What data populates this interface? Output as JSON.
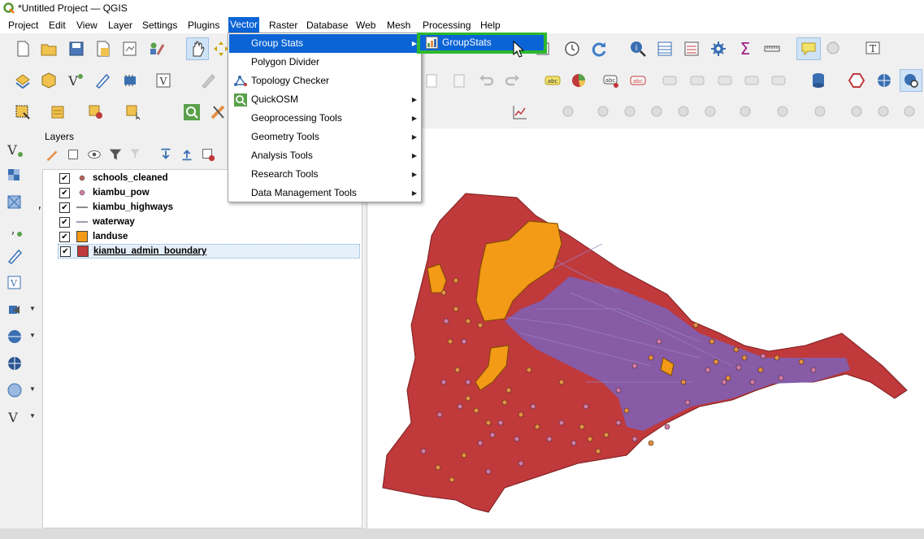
{
  "window": {
    "title": "*Untitled Project — QGIS"
  },
  "menubar": {
    "items": [
      "Project",
      "Edit",
      "View",
      "Layer",
      "Settings",
      "Plugins",
      "Vector",
      "Raster",
      "Database",
      "Web",
      "Mesh",
      "Processing",
      "Help"
    ],
    "active": "Vector"
  },
  "vector_menu": {
    "items": [
      {
        "label": "Group Stats",
        "icon": "none",
        "submenu": true
      },
      {
        "label": "Polygon Divider",
        "icon": "none",
        "submenu": false
      },
      {
        "label": "Topology Checker",
        "icon": "topology-icon",
        "submenu": false
      },
      {
        "label": "QuickOSM",
        "icon": "quickosm-icon",
        "submenu": true
      },
      {
        "label": "Geoprocessing Tools",
        "icon": "none",
        "submenu": true
      },
      {
        "label": "Geometry Tools",
        "icon": "none",
        "submenu": true
      },
      {
        "label": "Analysis Tools",
        "icon": "none",
        "submenu": true
      },
      {
        "label": "Research Tools",
        "icon": "none",
        "submenu": true
      },
      {
        "label": "Data Management Tools",
        "icon": "none",
        "submenu": true
      }
    ],
    "highlighted": "Group Stats"
  },
  "submenu": {
    "label": "GroupStats",
    "icon": "groupstats-icon"
  },
  "layers_panel": {
    "title": "Layers",
    "layers": [
      {
        "name": "schools_cleaned",
        "checked": true,
        "symbol": "point",
        "color": "#b5655a"
      },
      {
        "name": "kiambu_pow",
        "checked": true,
        "symbol": "point",
        "color": "#d27ba3"
      },
      {
        "name": "kiambu_highways",
        "checked": true,
        "symbol": "line",
        "color": "#666666"
      },
      {
        "name": "waterway",
        "checked": true,
        "symbol": "line",
        "color": "#7a7a9a"
      },
      {
        "name": "landuse",
        "checked": true,
        "symbol": "polygon",
        "color": "#f39a16"
      },
      {
        "name": "kiambu_admin_boundary",
        "checked": true,
        "symbol": "polygon",
        "color": "#c0393b"
      }
    ],
    "selected": "kiambu_admin_boundary"
  },
  "colors": {
    "menu_highlight": "#0a64d6",
    "submenu_outline": "#2db82d",
    "boundary": "#c0393b",
    "landuse": "#f39a16",
    "waterway": "#7d62b8",
    "schools": "#e48f45",
    "pow": "#d27ba3"
  }
}
